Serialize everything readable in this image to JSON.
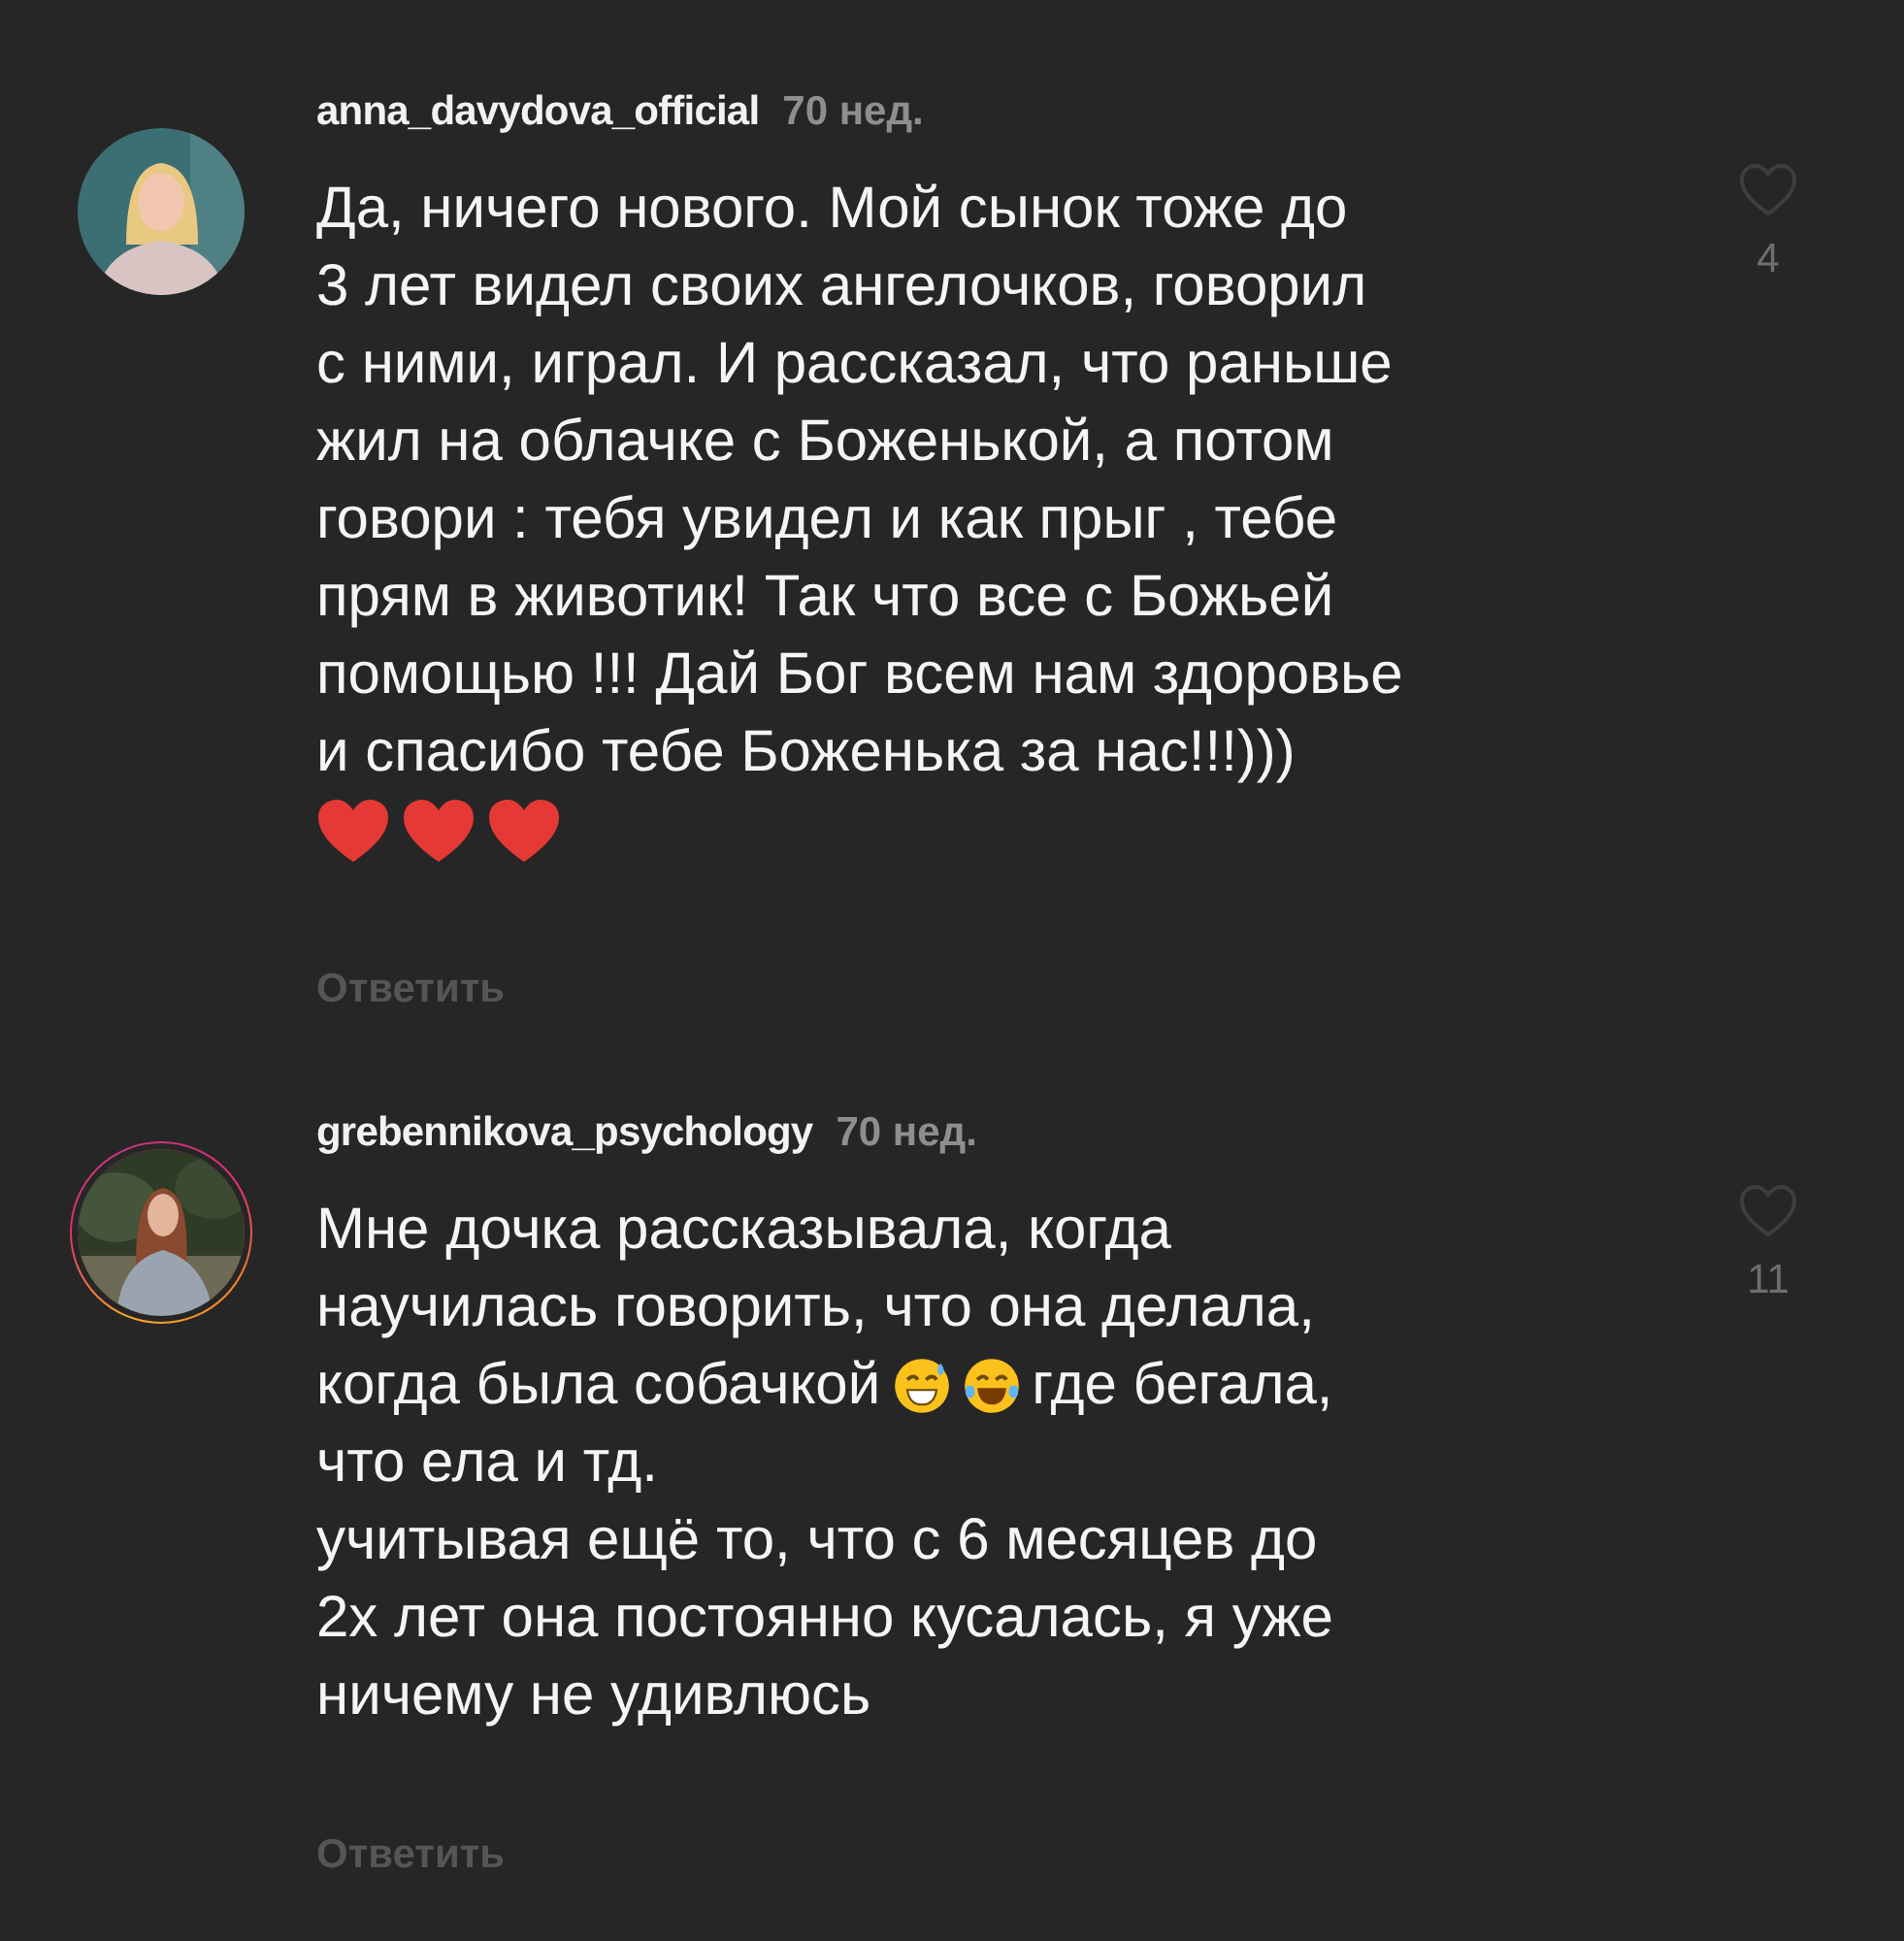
{
  "comments": [
    {
      "username": "anna_davydova_official",
      "time": "70 нед.",
      "story_ring": false,
      "liked": false,
      "likes": "4",
      "reply": "Ответить",
      "lines": [
        [
          {
            "kind": "text",
            "text": "Да, ничего нового. Мой сынок тоже до"
          }
        ],
        [
          {
            "kind": "text",
            "text": "3 лет видел своих ангелочков, говорил"
          }
        ],
        [
          {
            "kind": "text",
            "text": "с ними, играл. И рассказал, что раньше"
          }
        ],
        [
          {
            "kind": "text",
            "text": "жил на облачке с Боженькой, а потом"
          }
        ],
        [
          {
            "kind": "text",
            "text": "говори : тебя увидел и как прыг , тебе"
          }
        ],
        [
          {
            "kind": "text",
            "text": "прям в животик! Так что все с Божьей"
          }
        ],
        [
          {
            "kind": "text",
            "text": "помощью !!! Дай Бог всем нам здоровье"
          }
        ],
        [
          {
            "kind": "text",
            "text": "и спасибо тебе Боженька за нас!!!)))"
          }
        ],
        [
          {
            "kind": "heart"
          },
          {
            "kind": "heart"
          },
          {
            "kind": "heart"
          }
        ]
      ]
    },
    {
      "username": "grebennikova_psychology",
      "time": "70 нед.",
      "story_ring": true,
      "liked": false,
      "likes": "11",
      "reply": "Ответить",
      "lines": [
        [
          {
            "kind": "text",
            "text": "Мне дочка рассказывала, когда"
          }
        ],
        [
          {
            "kind": "text",
            "text": "научилась говорить, что она делала,"
          }
        ],
        [
          {
            "kind": "text",
            "text": "когда была собачкой"
          },
          {
            "kind": "sweat-smile"
          },
          {
            "kind": "tears-joy"
          },
          {
            "kind": "text",
            "text": "где бегала,"
          }
        ],
        [
          {
            "kind": "text",
            "text": "что ела и тд."
          }
        ],
        [
          {
            "kind": "text",
            "text": "учитывая ещё то, что с 6 месяцев до"
          }
        ],
        [
          {
            "kind": "text",
            "text": "2х лет она постоянно кусалась, я уже"
          }
        ],
        [
          {
            "kind": "text",
            "text": "ничему не удивлюсь"
          }
        ]
      ]
    }
  ]
}
